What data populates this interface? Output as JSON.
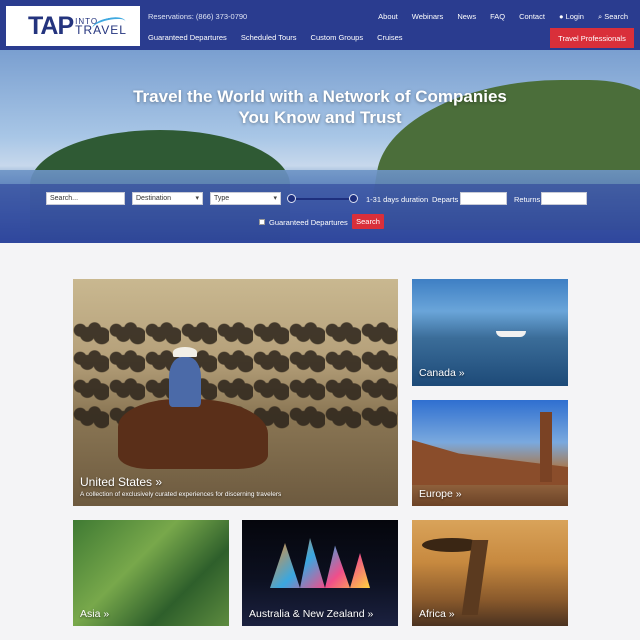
{
  "brand": {
    "logo_main": "TAP",
    "logo_into": "INTO",
    "logo_travel": "TRAVEL"
  },
  "header": {
    "reservations": "Reservations: (866) 373-0790",
    "util_nav": [
      "About",
      "Webinars",
      "News",
      "FAQ",
      "Contact",
      "Login",
      "Search"
    ],
    "main_nav": [
      "Guaranteed Departures",
      "Scheduled Tours",
      "Custom Groups",
      "Cruises"
    ],
    "pro_button": "Travel Professionals"
  },
  "hero": {
    "title_line1": "Travel the World with a Network of Companies",
    "title_line2": "You Know and Trust"
  },
  "search": {
    "placeholder": "Search...",
    "destination": "Destination",
    "type": "Type",
    "duration": "1-31 days duration",
    "departs_label": "Departs",
    "returns_label": "Returns",
    "guaranteed_label": "Guaranteed Departures",
    "button": "Search"
  },
  "cards": {
    "us": {
      "title": "United States »",
      "subtitle": "A collection of exclusively curated experiences for discerning travelers"
    },
    "canada": {
      "title": "Canada »"
    },
    "europe": {
      "title": "Europe »"
    },
    "asia": {
      "title": "Asia »"
    },
    "australia": {
      "title": "Australia & New Zealand »"
    },
    "africa": {
      "title": "Africa »"
    }
  },
  "colors": {
    "header": "#2a3c8f",
    "accent_red": "#d92f3a",
    "page_bg": "#f4f4f6"
  }
}
